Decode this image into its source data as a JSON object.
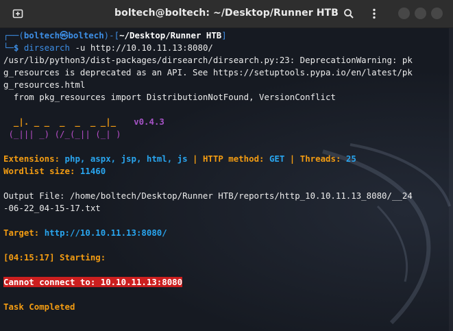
{
  "window": {
    "title": "boltech@boltech: ~/Desktop/Runner HTB",
    "icons": [
      "new-tab-icon",
      "search-icon",
      "kebab-menu-icon",
      "minimize-icon",
      "maximize-icon",
      "close-icon"
    ]
  },
  "prompt": {
    "top_prefix": "┌──(",
    "user": "boltech",
    "at_symbol": "㉿",
    "host": "boltech",
    "sep": ")-[",
    "path": "~/Desktop/Runner HTB",
    "close": "]",
    "bottom_prefix": "└─",
    "dollar": "$ ",
    "command": "dirsearch",
    "args": " -u http://10.10.11.13:8080/"
  },
  "warning": {
    "line1": "/usr/lib/python3/dist-packages/dirsearch/dirsearch.py:23: DeprecationWarning: pk",
    "line2": "g_resources is deprecated as an API. See https://setuptools.pypa.io/en/latest/pk",
    "line3": "g_resources.html",
    "line4": "  from pkg_resources import DistributionNotFound, VersionConflict"
  },
  "banner": {
    "art1": "  _|. _ _  _  _  _ _|_",
    "art2": " (_||| _) (/_(_|| (_| )",
    "version": "v0.4.3"
  },
  "config": {
    "extensions_label": "Extensions: ",
    "extensions_value": "php, aspx, jsp, html, js",
    "pipe": " | ",
    "method_label": "HTTP method: ",
    "method_value": "GET",
    "threads_label": "Threads: ",
    "threads_value": "25",
    "wordlist_label": "Wordlist size: ",
    "wordlist_value": "11460"
  },
  "output": {
    "line1": "Output File: /home/boltech/Desktop/Runner HTB/reports/http_10.10.11.13_8080/__24",
    "line2": "-06-22_04-15-17.txt"
  },
  "target": {
    "label": "Target: ",
    "value": "http://10.10.11.13:8080/"
  },
  "starting": "[04:15:17] Starting:",
  "error": "Cannot connect to: 10.10.11.13:8080",
  "completed": "Task Completed",
  "colors": {
    "titlebar": "#2e2e2e",
    "background": "#161a22",
    "accent_blue": "#3d8ee5",
    "orange": "#f39c12",
    "cyan": "#29a6f0",
    "error_red": "#cc1f1f"
  }
}
